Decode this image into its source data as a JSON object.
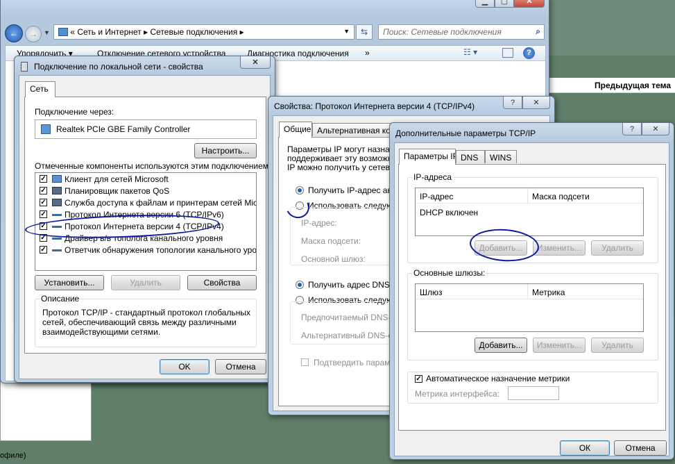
{
  "explorer": {
    "breadcrumb": [
      "Сеть и Интернет",
      "Сетевые подключения"
    ],
    "search_placeholder": "Поиск: Сетевые подключения",
    "toolbar": {
      "organize": "Упорядочить",
      "disable": "Отключение сетевого устройства",
      "diagnose": "Диагностика подключения",
      "more": "»"
    }
  },
  "background": {
    "forum_label": "Предыдущая тема",
    "footer_text": "офиле)"
  },
  "lan_dialog": {
    "title": "Подключение по локальной сети - свойства",
    "tab": "Сеть",
    "connect_using_label": "Подключение через:",
    "adapter": "Realtek PCIe GBE Family Controller",
    "configure_button": "Настроить...",
    "components_label": "Отмеченные компоненты используются этим подключением:",
    "components": [
      {
        "label": "Клиент для сетей Microsoft",
        "icon": "network-client-icon"
      },
      {
        "label": "Планировщик пакетов QoS",
        "icon": "service-icon"
      },
      {
        "label": "Служба доступа к файлам и принтерам сетей Micro...",
        "icon": "service-icon"
      },
      {
        "label": "Протокол Интернета версии 6 (TCP/IPv6)",
        "icon": "protocol-icon"
      },
      {
        "label": "Протокол Интернета версии 4 (TCP/IPv4)",
        "icon": "protocol-icon"
      },
      {
        "label": "Драйвер в/в тополога канального уровня",
        "icon": "protocol-icon"
      },
      {
        "label": "Ответчик обнаружения топологии канального уровня",
        "icon": "protocol-icon"
      }
    ],
    "install_button": "Установить...",
    "remove_button": "Удалить",
    "properties_button": "Свойства",
    "description_group": "Описание",
    "description_text": "Протокол TCP/IP - стандартный протокол глобальных сетей, обеспечивающий связь между различными взаимодействующими сетями.",
    "ok_button": "OK",
    "cancel_button": "Отмена"
  },
  "ipv4_dialog": {
    "title": "Свойства: Протокол Интернета версии 4 (TCP/IPv4)",
    "tab_general": "Общие",
    "tab_alternate": "Альтернативная конфигурация",
    "intro_text": [
      "Параметры IP могут назначаться автоматически, если сеть",
      "поддерживает эту возможность. В противном случае",
      "IP можно получить у сетевого администратора."
    ],
    "auto_ip": "Получить IP-адрес автоматически",
    "manual_ip": "Использовать следующий IP-адрес:",
    "ip_address_label": "IP-адрес:",
    "subnet_label": "Маска подсети:",
    "gateway_label": "Основной шлюз:",
    "auto_dns": "Получить адрес DNS-сервера автоматически",
    "manual_dns": "Использовать следующие адреса DNS-серверов:",
    "preferred_dns_label": "Предпочитаемый DNS-сервер:",
    "alternate_dns_label": "Альтернативный DNS-сервер:",
    "validate_label": "Подтвердить параметры при выходе"
  },
  "advanced_dialog": {
    "title": "Дополнительные параметры TCP/IP",
    "tabs": [
      "Параметры IP",
      "DNS",
      "WINS"
    ],
    "ip_group": "IP-адреса",
    "ip_columns": [
      "IP-адрес",
      "Маска подсети"
    ],
    "ip_rows": [
      "DHCP включен"
    ],
    "add_button": "Добавить...",
    "edit_button": "Изменить...",
    "remove_button": "Удалить",
    "gateways_group": "Основные шлюзы:",
    "gateway_columns": [
      "Шлюз",
      "Метрика"
    ],
    "auto_metric_label": "Автоматическое назначение метрики",
    "interface_metric_label": "Метрика интерфейса:",
    "ok_button": "ОК",
    "cancel_button": "Отмена"
  },
  "colors": {
    "annotation_ink": "#0b1a9c",
    "window_frame": "#b4c8de"
  }
}
